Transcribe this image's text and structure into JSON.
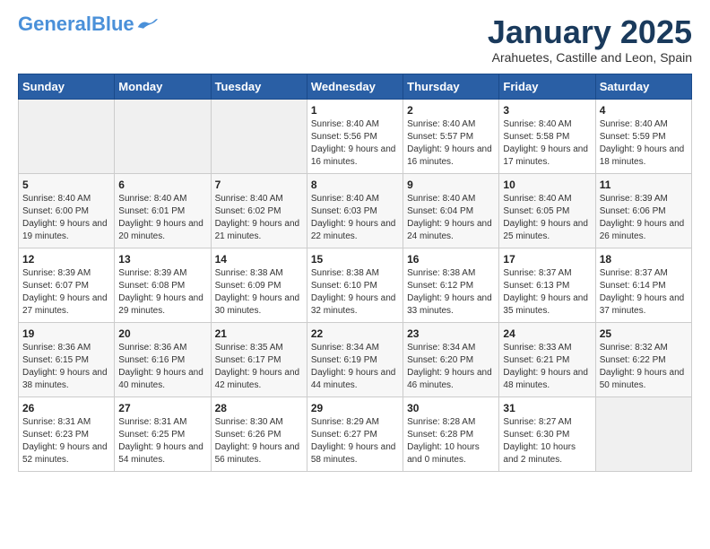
{
  "header": {
    "logo_general": "General",
    "logo_blue": "Blue",
    "month_title": "January 2025",
    "subtitle": "Arahuetes, Castille and Leon, Spain"
  },
  "weekdays": [
    "Sunday",
    "Monday",
    "Tuesday",
    "Wednesday",
    "Thursday",
    "Friday",
    "Saturday"
  ],
  "weeks": [
    [
      {
        "day": "",
        "sunrise": "",
        "sunset": "",
        "daylight": ""
      },
      {
        "day": "",
        "sunrise": "",
        "sunset": "",
        "daylight": ""
      },
      {
        "day": "",
        "sunrise": "",
        "sunset": "",
        "daylight": ""
      },
      {
        "day": "1",
        "sunrise": "Sunrise: 8:40 AM",
        "sunset": "Sunset: 5:56 PM",
        "daylight": "Daylight: 9 hours and 16 minutes."
      },
      {
        "day": "2",
        "sunrise": "Sunrise: 8:40 AM",
        "sunset": "Sunset: 5:57 PM",
        "daylight": "Daylight: 9 hours and 16 minutes."
      },
      {
        "day": "3",
        "sunrise": "Sunrise: 8:40 AM",
        "sunset": "Sunset: 5:58 PM",
        "daylight": "Daylight: 9 hours and 17 minutes."
      },
      {
        "day": "4",
        "sunrise": "Sunrise: 8:40 AM",
        "sunset": "Sunset: 5:59 PM",
        "daylight": "Daylight: 9 hours and 18 minutes."
      }
    ],
    [
      {
        "day": "5",
        "sunrise": "Sunrise: 8:40 AM",
        "sunset": "Sunset: 6:00 PM",
        "daylight": "Daylight: 9 hours and 19 minutes."
      },
      {
        "day": "6",
        "sunrise": "Sunrise: 8:40 AM",
        "sunset": "Sunset: 6:01 PM",
        "daylight": "Daylight: 9 hours and 20 minutes."
      },
      {
        "day": "7",
        "sunrise": "Sunrise: 8:40 AM",
        "sunset": "Sunset: 6:02 PM",
        "daylight": "Daylight: 9 hours and 21 minutes."
      },
      {
        "day": "8",
        "sunrise": "Sunrise: 8:40 AM",
        "sunset": "Sunset: 6:03 PM",
        "daylight": "Daylight: 9 hours and 22 minutes."
      },
      {
        "day": "9",
        "sunrise": "Sunrise: 8:40 AM",
        "sunset": "Sunset: 6:04 PM",
        "daylight": "Daylight: 9 hours and 24 minutes."
      },
      {
        "day": "10",
        "sunrise": "Sunrise: 8:40 AM",
        "sunset": "Sunset: 6:05 PM",
        "daylight": "Daylight: 9 hours and 25 minutes."
      },
      {
        "day": "11",
        "sunrise": "Sunrise: 8:39 AM",
        "sunset": "Sunset: 6:06 PM",
        "daylight": "Daylight: 9 hours and 26 minutes."
      }
    ],
    [
      {
        "day": "12",
        "sunrise": "Sunrise: 8:39 AM",
        "sunset": "Sunset: 6:07 PM",
        "daylight": "Daylight: 9 hours and 27 minutes."
      },
      {
        "day": "13",
        "sunrise": "Sunrise: 8:39 AM",
        "sunset": "Sunset: 6:08 PM",
        "daylight": "Daylight: 9 hours and 29 minutes."
      },
      {
        "day": "14",
        "sunrise": "Sunrise: 8:38 AM",
        "sunset": "Sunset: 6:09 PM",
        "daylight": "Daylight: 9 hours and 30 minutes."
      },
      {
        "day": "15",
        "sunrise": "Sunrise: 8:38 AM",
        "sunset": "Sunset: 6:10 PM",
        "daylight": "Daylight: 9 hours and 32 minutes."
      },
      {
        "day": "16",
        "sunrise": "Sunrise: 8:38 AM",
        "sunset": "Sunset: 6:12 PM",
        "daylight": "Daylight: 9 hours and 33 minutes."
      },
      {
        "day": "17",
        "sunrise": "Sunrise: 8:37 AM",
        "sunset": "Sunset: 6:13 PM",
        "daylight": "Daylight: 9 hours and 35 minutes."
      },
      {
        "day": "18",
        "sunrise": "Sunrise: 8:37 AM",
        "sunset": "Sunset: 6:14 PM",
        "daylight": "Daylight: 9 hours and 37 minutes."
      }
    ],
    [
      {
        "day": "19",
        "sunrise": "Sunrise: 8:36 AM",
        "sunset": "Sunset: 6:15 PM",
        "daylight": "Daylight: 9 hours and 38 minutes."
      },
      {
        "day": "20",
        "sunrise": "Sunrise: 8:36 AM",
        "sunset": "Sunset: 6:16 PM",
        "daylight": "Daylight: 9 hours and 40 minutes."
      },
      {
        "day": "21",
        "sunrise": "Sunrise: 8:35 AM",
        "sunset": "Sunset: 6:17 PM",
        "daylight": "Daylight: 9 hours and 42 minutes."
      },
      {
        "day": "22",
        "sunrise": "Sunrise: 8:34 AM",
        "sunset": "Sunset: 6:19 PM",
        "daylight": "Daylight: 9 hours and 44 minutes."
      },
      {
        "day": "23",
        "sunrise": "Sunrise: 8:34 AM",
        "sunset": "Sunset: 6:20 PM",
        "daylight": "Daylight: 9 hours and 46 minutes."
      },
      {
        "day": "24",
        "sunrise": "Sunrise: 8:33 AM",
        "sunset": "Sunset: 6:21 PM",
        "daylight": "Daylight: 9 hours and 48 minutes."
      },
      {
        "day": "25",
        "sunrise": "Sunrise: 8:32 AM",
        "sunset": "Sunset: 6:22 PM",
        "daylight": "Daylight: 9 hours and 50 minutes."
      }
    ],
    [
      {
        "day": "26",
        "sunrise": "Sunrise: 8:31 AM",
        "sunset": "Sunset: 6:23 PM",
        "daylight": "Daylight: 9 hours and 52 minutes."
      },
      {
        "day": "27",
        "sunrise": "Sunrise: 8:31 AM",
        "sunset": "Sunset: 6:25 PM",
        "daylight": "Daylight: 9 hours and 54 minutes."
      },
      {
        "day": "28",
        "sunrise": "Sunrise: 8:30 AM",
        "sunset": "Sunset: 6:26 PM",
        "daylight": "Daylight: 9 hours and 56 minutes."
      },
      {
        "day": "29",
        "sunrise": "Sunrise: 8:29 AM",
        "sunset": "Sunset: 6:27 PM",
        "daylight": "Daylight: 9 hours and 58 minutes."
      },
      {
        "day": "30",
        "sunrise": "Sunrise: 8:28 AM",
        "sunset": "Sunset: 6:28 PM",
        "daylight": "Daylight: 10 hours and 0 minutes."
      },
      {
        "day": "31",
        "sunrise": "Sunrise: 8:27 AM",
        "sunset": "Sunset: 6:30 PM",
        "daylight": "Daylight: 10 hours and 2 minutes."
      },
      {
        "day": "",
        "sunrise": "",
        "sunset": "",
        "daylight": ""
      }
    ]
  ]
}
